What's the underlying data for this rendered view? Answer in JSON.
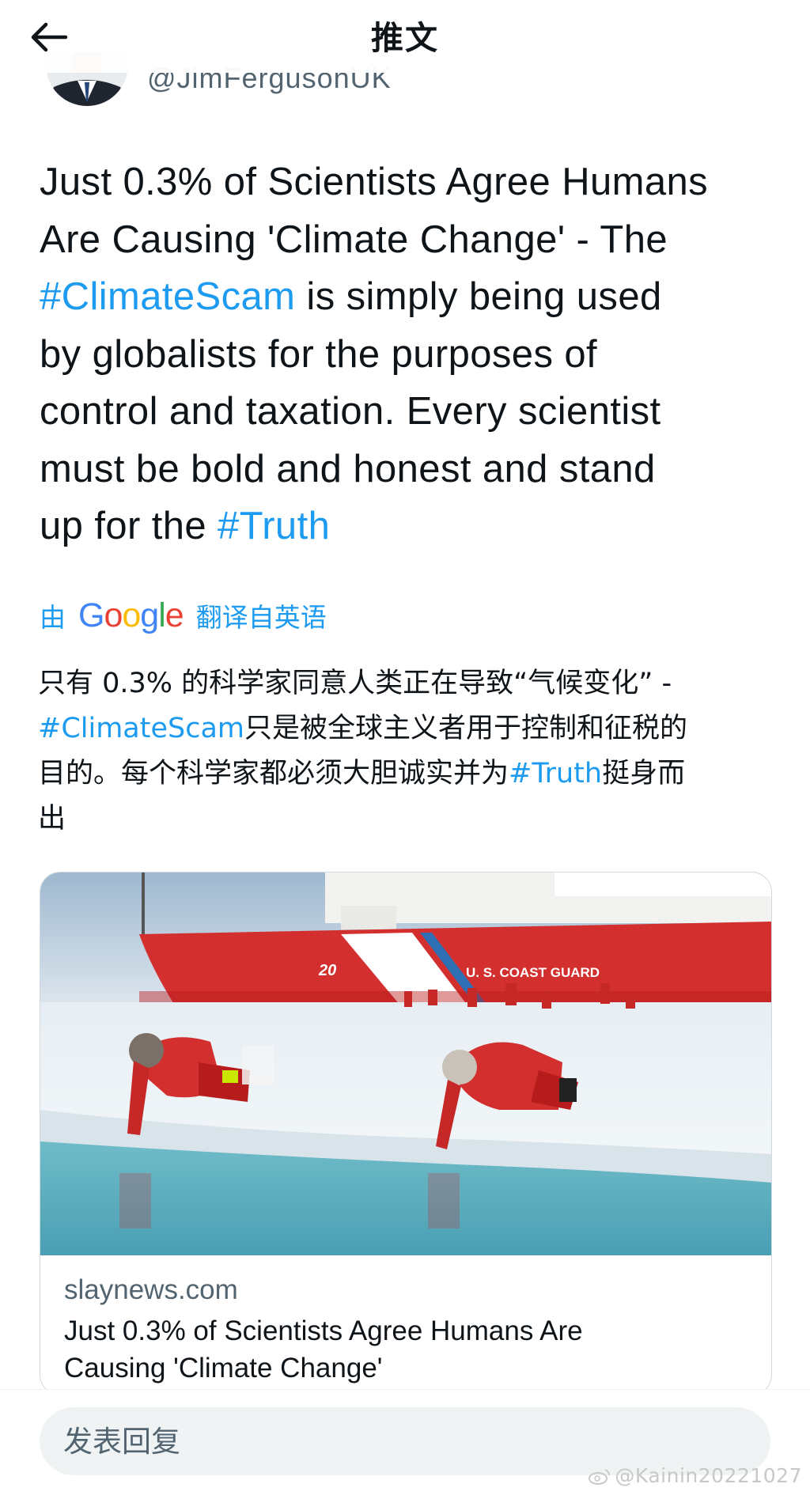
{
  "header": {
    "title": "推文",
    "back_icon": "arrow-left-icon"
  },
  "author": {
    "handle": "@JimFergusonUK"
  },
  "tweet": {
    "lines": [
      [
        "Just 0.3% of Scientists Agree Humans"
      ],
      [
        "Are Causing 'Climate Change' - The"
      ],
      [
        "#ClimateScam",
        " is simply being used"
      ],
      [
        "by globalists for the purposes of"
      ],
      [
        "control and taxation. Every scientist"
      ],
      [
        "must be bold and honest and stand"
      ],
      [
        "up for the ",
        "#Truth"
      ]
    ]
  },
  "translation": {
    "prefix": "由",
    "brand": "Google",
    "suffix": "翻译自英语",
    "lines": [
      [
        "只有 0.3% 的科学家同意人类正在导致“气候变化” -"
      ],
      [
        "#ClimateScam",
        "只是被全球主义者用于控制和征税的"
      ],
      [
        "目的。每个科学家都必须大胆诚实并为",
        "#Truth",
        "挺身而"
      ],
      [
        "出"
      ]
    ]
  },
  "card": {
    "image_alt": "U.S. Coast Guard icebreaker 20 behind researchers in red suits sampling meltwater on sea ice",
    "ship_number": "20",
    "ship_text": "U. S. COAST GUARD",
    "domain": "slaynews.com",
    "title_lines": [
      "Just 0.3% of Scientists Agree Humans Are",
      "Causing 'Climate Change'"
    ]
  },
  "reply": {
    "placeholder": "发表回复"
  },
  "watermark": {
    "text": "@Kainin20221027",
    "icon": "weibo-logo-icon"
  },
  "colors": {
    "hashtag": "#1d9bf0",
    "text": "#0f1419",
    "secondary": "#536471"
  }
}
